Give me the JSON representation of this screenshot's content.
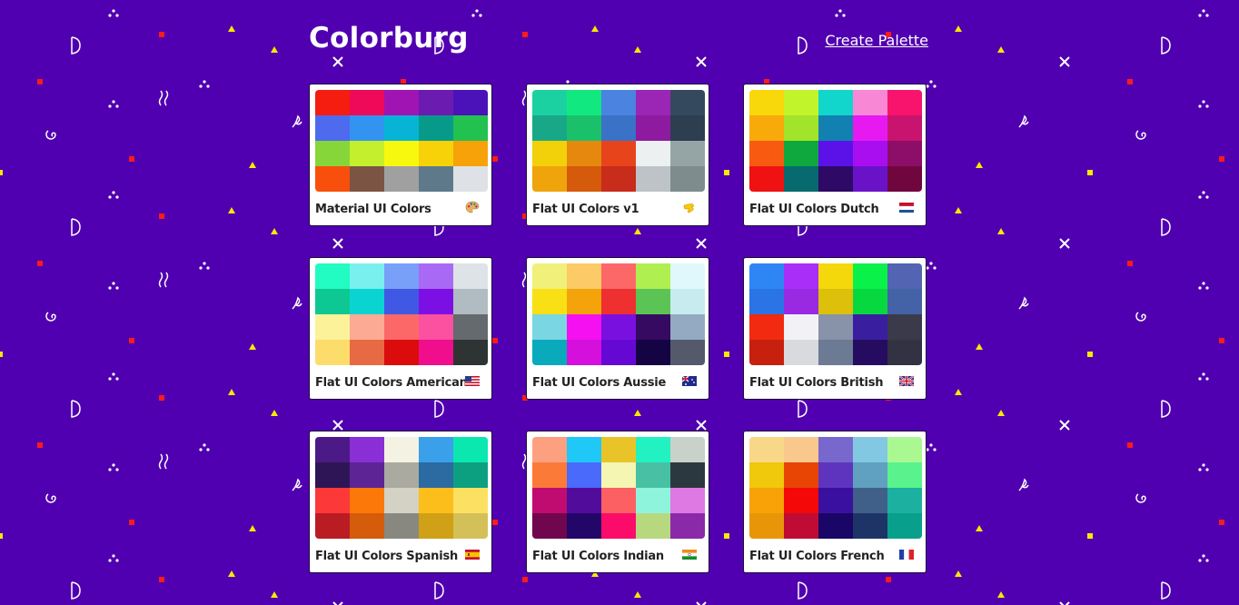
{
  "app": {
    "logo": "Colorburg",
    "create_link": "Create Palette"
  },
  "theme": {
    "background": "#5000b0"
  },
  "palettes": [
    {
      "name": "Material UI Colors",
      "emoji_icon": "artist-palette-icon",
      "colors": [
        "#f51d0f",
        "#ee0a59",
        "#a014b4",
        "#6c1bb1",
        "#4a12b8",
        "#4e6bf0",
        "#3294f0",
        "#08b4d6",
        "#079a8a",
        "#22c150",
        "#86d63a",
        "#c4ef2c",
        "#f8f80e",
        "#f8d208",
        "#f8a20a",
        "#f8500c",
        "#7c5444",
        "#a0a0a0",
        "#5e7a8a",
        "#dee2e6"
      ]
    },
    {
      "name": "Flat UI Colors v1",
      "emoji_icon": "hand-thumb-icon",
      "colors": [
        "#1cd1a1",
        "#12e880",
        "#4a84e0",
        "#9b26b6",
        "#34495e",
        "#18a888",
        "#1ac16a",
        "#3a72c8",
        "#8e1aa0",
        "#2c3e50",
        "#f2d00a",
        "#e6880e",
        "#e8441c",
        "#ecf0f1",
        "#95a5a6",
        "#f0a40c",
        "#d65a0c",
        "#c82c1a",
        "#bdc3c7",
        "#7f8c8d"
      ]
    },
    {
      "name": "Flat UI Colors Dutch",
      "emoji_icon": "netherlands-flag-icon",
      "colors": [
        "#f8d80a",
        "#c2f42c",
        "#12d6cc",
        "#f888d6",
        "#f8146c",
        "#f8aa0a",
        "#a2e42a",
        "#1280b0",
        "#e61af0",
        "#c8146e",
        "#f85a10",
        "#0ea83e",
        "#5a12e8",
        "#a80ef0",
        "#8c0e68",
        "#ee1212",
        "#066a6e",
        "#2e0a66",
        "#6a12c8",
        "#70063e"
      ]
    },
    {
      "name": "Flat UI Colors American",
      "emoji_icon": "us-flag-icon",
      "colors": [
        "#22fcc2",
        "#7af0ee",
        "#78a0f8",
        "#a86af4",
        "#dde3e6",
        "#0ec894",
        "#0ad4d2",
        "#4058e4",
        "#7c10e4",
        "#b0bcc2",
        "#fcf29a",
        "#fcaa94",
        "#fc6868",
        "#fc50a0",
        "#646a6e",
        "#fcdc6a",
        "#e86a44",
        "#dc0c0c",
        "#f00e8c",
        "#2e3434"
      ]
    },
    {
      "name": "Flat UI Colors Aussie",
      "emoji_icon": "australia-flag-icon",
      "colors": [
        "#f0f07a",
        "#fcca66",
        "#fc6868",
        "#b0ef50",
        "#e0f8fc",
        "#f8e014",
        "#f4a40a",
        "#ee3030",
        "#5cc454",
        "#c6ecef",
        "#7ad6e2",
        "#f410f0",
        "#7a10e0",
        "#360a60",
        "#94aac2",
        "#08aabc",
        "#d610dc",
        "#6608d4",
        "#140444",
        "#545a6c"
      ]
    },
    {
      "name": "Flat UI Colors British",
      "emoji_icon": "uk-flag-icon",
      "colors": [
        "#2e86f4",
        "#a82ef8",
        "#f4d80c",
        "#0af24a",
        "#5264b2",
        "#2a74e6",
        "#9a2ae2",
        "#dcc00a",
        "#08d840",
        "#4462a6",
        "#f22a10",
        "#f2f2f6",
        "#8892a8",
        "#3a1ea0",
        "#3a3a4a",
        "#c8200e",
        "#d8dade",
        "#6c7a94",
        "#250c60",
        "#323242"
      ]
    },
    {
      "name": "Flat UI Colors Spanish",
      "emoji_icon": "spain-flag-icon",
      "colors": [
        "#4c1a86",
        "#8a2ed6",
        "#f4f2e2",
        "#3aa0ea",
        "#0ae8b0",
        "#2e1656",
        "#5c2494",
        "#aaaaa0",
        "#2c6aa2",
        "#0ca080",
        "#fc3838",
        "#fc7808",
        "#d4d2c4",
        "#fcbe1a",
        "#fce062",
        "#ba1c24",
        "#d45c0a",
        "#888880",
        "#d0a016",
        "#d4c058"
      ]
    },
    {
      "name": "Flat UI Colors Indian",
      "emoji_icon": "india-flag-icon",
      "colors": [
        "#fca080",
        "#20c8f8",
        "#e8c428",
        "#22f2c2",
        "#c8d2c8",
        "#fc7a38",
        "#4a6afc",
        "#f4f6b2",
        "#48c0a4",
        "#2c3840",
        "#c00c70",
        "#520c9c",
        "#fc6062",
        "#8ef4dc",
        "#de78e2",
        "#70064e",
        "#220668",
        "#fc0c6a",
        "#b8d880",
        "#8a2aa8"
      ]
    },
    {
      "name": "Flat UI Colors French",
      "emoji_icon": "france-flag-icon",
      "colors": [
        "#f8d888",
        "#f8c88c",
        "#7868ce",
        "#82c8e2",
        "#aaf892",
        "#f0c80c",
        "#e84404",
        "#5e34be",
        "#60a0c0",
        "#5af28c",
        "#f8a208",
        "#f40808",
        "#3a10a0",
        "#40608a",
        "#1cb0a0",
        "#e89608",
        "#c00c34",
        "#1a0666",
        "#1e3466",
        "#08a08c"
      ]
    }
  ]
}
